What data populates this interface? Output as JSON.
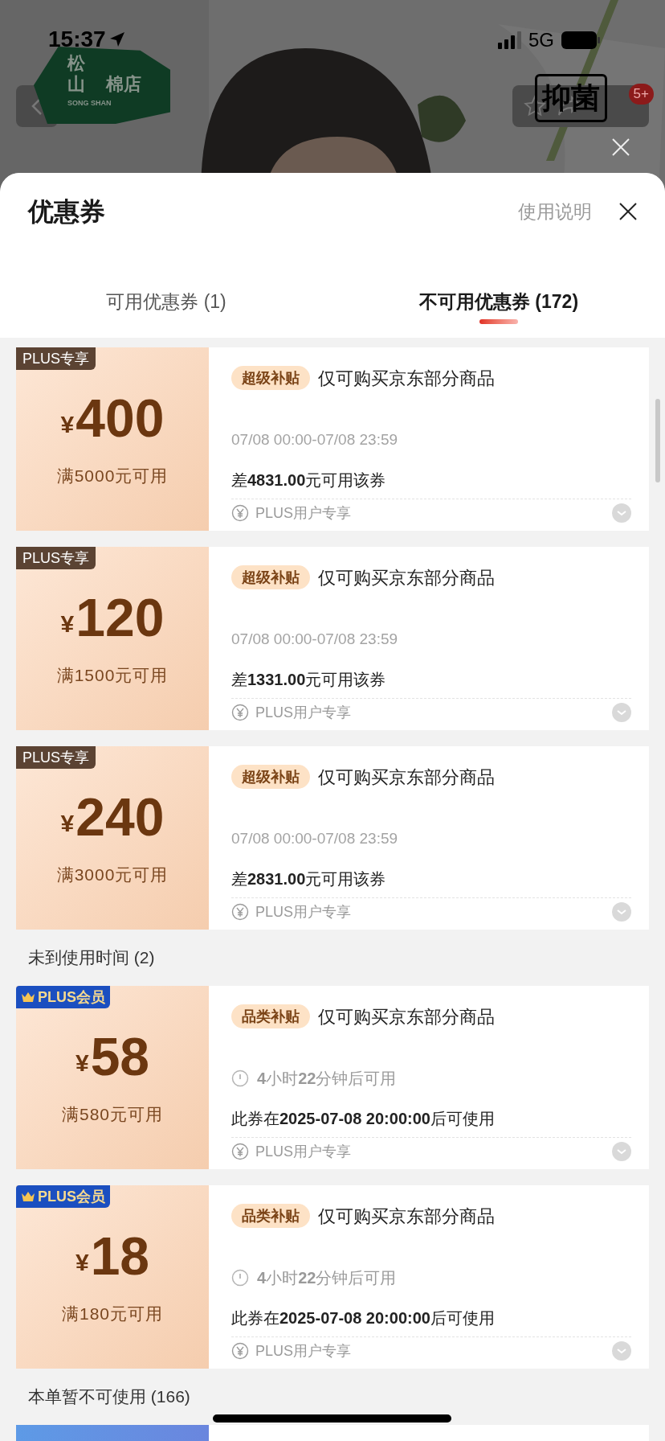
{
  "status_bar": {
    "time": "15:37",
    "network": "5G"
  },
  "store_logo": {
    "line_1": "松",
    "line_2": "山",
    "side": "棉店",
    "latin": "SONG SHAN"
  },
  "promo_label": "抑菌",
  "cart_badge": "5+",
  "sheet": {
    "title": "优惠券",
    "help_link": "使用说明"
  },
  "tabs": [
    {
      "label": "可用优惠券 (1)",
      "selected": false
    },
    {
      "label": "不可用优惠券 (172)",
      "selected": true
    }
  ],
  "groups": [
    {
      "coupons": [
        {
          "kind": "time_range",
          "badge": {
            "kind": "plus_exclusive",
            "text": "PLUS专享"
          },
          "currency": "¥",
          "amount": "400",
          "threshold": "满5000元可用",
          "tag": "超级补贴",
          "scope": "仅可购买京东部分商品",
          "validity": "07/08 00:00-07/08 23:59",
          "condition": "差**4831.00**元可用该券",
          "footer": "PLUS用户专享"
        },
        {
          "kind": "time_range",
          "badge": {
            "kind": "plus_exclusive",
            "text": "PLUS专享"
          },
          "currency": "¥",
          "amount": "120",
          "threshold": "满1500元可用",
          "tag": "超级补贴",
          "scope": "仅可购买京东部分商品",
          "validity": "07/08 00:00-07/08 23:59",
          "condition": "差**1331.00**元可用该券",
          "footer": "PLUS用户专享"
        },
        {
          "kind": "time_range",
          "badge": {
            "kind": "plus_exclusive",
            "text": "PLUS专享"
          },
          "currency": "¥",
          "amount": "240",
          "threshold": "满3000元可用",
          "tag": "超级补贴",
          "scope": "仅可购买京东部分商品",
          "validity": "07/08 00:00-07/08 23:59",
          "condition": "差**2831.00**元可用该券",
          "footer": "PLUS用户专享"
        }
      ]
    },
    {
      "heading": "未到使用时间 (2)",
      "coupons": [
        {
          "kind": "countdown",
          "badge": {
            "kind": "plus_member",
            "text": "PLUS会员"
          },
          "currency": "¥",
          "amount": "58",
          "threshold": "满580元可用",
          "tag": "品类补贴",
          "scope": "仅可购买京东部分商品",
          "validity": "**4**小时**22**分钟后可用",
          "condition": "此券在**2025-07-08 20:00:00**后可使用",
          "footer": "PLUS用户专享"
        },
        {
          "kind": "countdown",
          "badge": {
            "kind": "plus_member",
            "text": "PLUS会员"
          },
          "currency": "¥",
          "amount": "18",
          "threshold": "满180元可用",
          "tag": "品类补贴",
          "scope": "仅可购买京东部分商品",
          "validity": "**4**小时**22**分钟后可用",
          "condition": "此券在**2025-07-08 20:00:00**后可使用",
          "footer": "PLUS用户专享"
        }
      ]
    },
    {
      "heading": "本单暂不可使用 (166)",
      "coupons": [
        {
          "kind": "cut_off"
        }
      ]
    }
  ]
}
